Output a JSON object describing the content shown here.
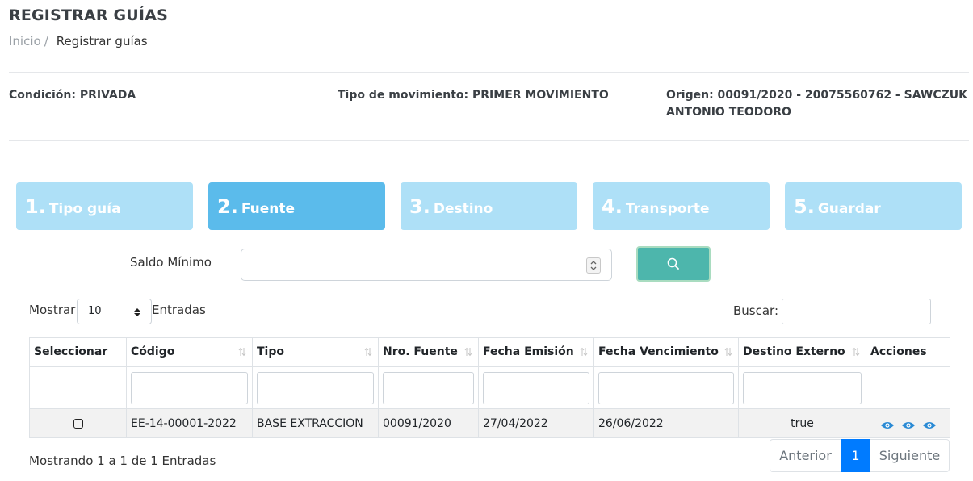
{
  "header": {
    "title": "REGISTRAR GUÍAS",
    "breadcrumb": {
      "home": "Inicio",
      "separator": "/",
      "current": "Registrar guías"
    }
  },
  "info": {
    "condicion": "Condición: PRIVADA",
    "tipo_movimiento": "Tipo de movimiento: PRIMER MOVIMIENTO",
    "origen_line1": "Origen: 00091/2020 - 20075560762 - SAWCZUK",
    "origen_line2": "ANTONIO TEODORO"
  },
  "steps": [
    {
      "number": "1.",
      "label": "Tipo guía",
      "active": false
    },
    {
      "number": "2.",
      "label": "Fuente",
      "active": true
    },
    {
      "number": "3.",
      "label": "Destino",
      "active": false
    },
    {
      "number": "4.",
      "label": "Transporte",
      "active": false
    },
    {
      "number": "5.",
      "label": "Guardar",
      "active": false
    }
  ],
  "saldo": {
    "label": "Saldo Mínimo",
    "value": ""
  },
  "table_controls": {
    "show_prefix": "Mostrar",
    "page_length": "10",
    "show_suffix": "Entradas",
    "search_label": "Buscar:",
    "search_value": ""
  },
  "table": {
    "columns": [
      "Seleccionar",
      "Código",
      "Tipo",
      "Nro. Fuente",
      "Fecha Emisión",
      "Fecha Vencimiento",
      "Destino Externo",
      "Acciones"
    ],
    "rows": [
      {
        "codigo": "EE-14-00001-2022",
        "tipo": "BASE EXTRACCION",
        "nro_fuente": "00091/2020",
        "fecha_emision": "27/04/2022",
        "fecha_vencimiento": "26/06/2022",
        "destino_externo": "true"
      }
    ]
  },
  "footer": {
    "info": "Mostrando 1 a 1 de 1 Entradas",
    "prev": "Anterior",
    "page": "1",
    "next": "Siguiente"
  },
  "colors": {
    "step_inactive": "#aee0f7",
    "step_active": "#5bbbeb",
    "search_button": "#4db6ac",
    "eye_icon": "#2a8ad4",
    "page_active": "#007bff"
  }
}
